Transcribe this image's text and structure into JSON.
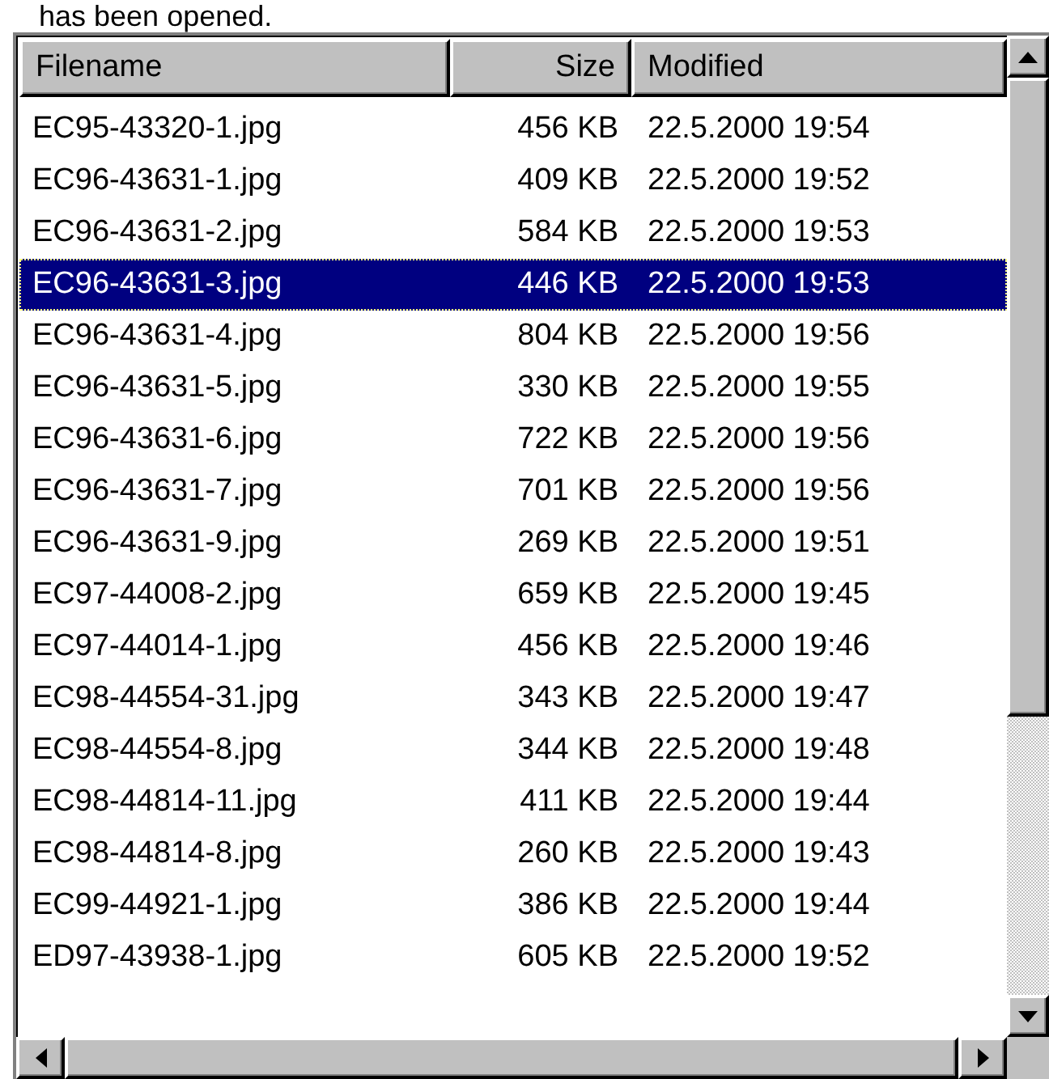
{
  "caption": "has been opened.",
  "table": {
    "columns": [
      {
        "label": "Filename"
      },
      {
        "label": "Size"
      },
      {
        "label": "Modified"
      }
    ],
    "rows": [
      {
        "cells": [
          "EC95-43320-1.jpg",
          "456 KB",
          "22.5.2000 19:54"
        ],
        "selected": false
      },
      {
        "cells": [
          "EC96-43631-1.jpg",
          "409 KB",
          "22.5.2000 19:52"
        ],
        "selected": false
      },
      {
        "cells": [
          "EC96-43631-2.jpg",
          "584 KB",
          "22.5.2000 19:53"
        ],
        "selected": false
      },
      {
        "cells": [
          "EC96-43631-3.jpg",
          "446 KB",
          "22.5.2000 19:53"
        ],
        "selected": true
      },
      {
        "cells": [
          "EC96-43631-4.jpg",
          "804 KB",
          "22.5.2000 19:56"
        ],
        "selected": false
      },
      {
        "cells": [
          "EC96-43631-5.jpg",
          "330 KB",
          "22.5.2000 19:55"
        ],
        "selected": false
      },
      {
        "cells": [
          "EC96-43631-6.jpg",
          "722 KB",
          "22.5.2000 19:56"
        ],
        "selected": false
      },
      {
        "cells": [
          "EC96-43631-7.jpg",
          "701 KB",
          "22.5.2000 19:56"
        ],
        "selected": false
      },
      {
        "cells": [
          "EC96-43631-9.jpg",
          "269 KB",
          "22.5.2000 19:51"
        ],
        "selected": false
      },
      {
        "cells": [
          "EC97-44008-2.jpg",
          "659 KB",
          "22.5.2000 19:45"
        ],
        "selected": false
      },
      {
        "cells": [
          "EC97-44014-1.jpg",
          "456 KB",
          "22.5.2000 19:46"
        ],
        "selected": false
      },
      {
        "cells": [
          "EC98-44554-31.jpg",
          "343 KB",
          "22.5.2000 19:47"
        ],
        "selected": false
      },
      {
        "cells": [
          "EC98-44554-8.jpg",
          "344 KB",
          "22.5.2000 19:48"
        ],
        "selected": false
      },
      {
        "cells": [
          "EC98-44814-11.jpg",
          "411 KB",
          "22.5.2000 19:44"
        ],
        "selected": false
      },
      {
        "cells": [
          "EC98-44814-8.jpg",
          "260 KB",
          "22.5.2000 19:43"
        ],
        "selected": false
      },
      {
        "cells": [
          "EC99-44921-1.jpg",
          "386 KB",
          "22.5.2000 19:44"
        ],
        "selected": false
      },
      {
        "cells": [
          "ED97-43938-1.jpg",
          "605 KB",
          "22.5.2000 19:52"
        ],
        "selected": false
      }
    ]
  }
}
